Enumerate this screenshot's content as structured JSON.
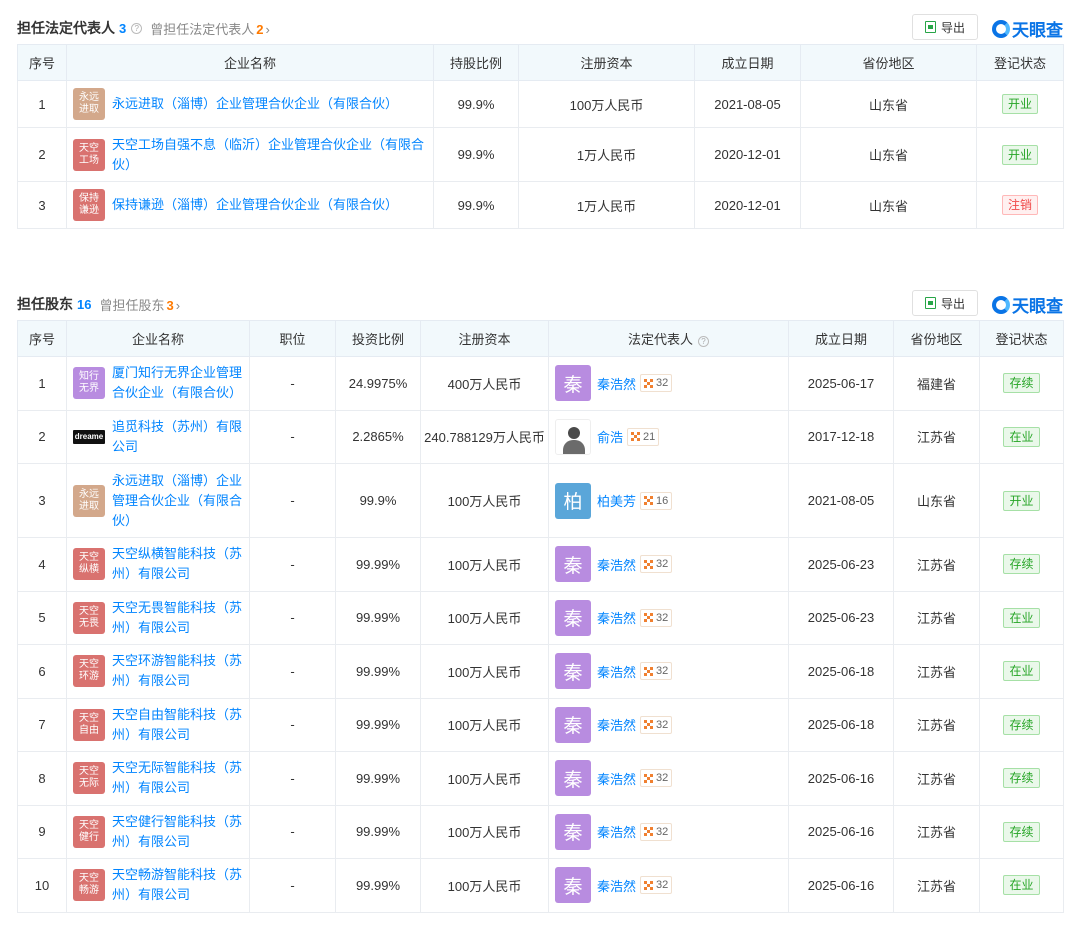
{
  "colors": {
    "accent": "#0084ff",
    "brand": "#0a74e6",
    "count_orange": "#ff7a00",
    "header_bg": "#f2f9fc",
    "status_green": "#26a526",
    "status_red": "#f04848"
  },
  "brand_text": "天眼查",
  "export_label": "导出",
  "legal_rep": {
    "title": "担任法定代表人",
    "count": "3",
    "former_label": "曾担任法定代表人",
    "former_count": "2",
    "headers": [
      "序号",
      "企业名称",
      "持股比例",
      "注册资本",
      "成立日期",
      "省份地区",
      "登记状态"
    ],
    "rows": [
      {
        "index": "1",
        "logo": "永远进取",
        "name": "永远进取（淄博）企业管理合伙企业（有限合伙）",
        "share": "99.9%",
        "capital": "100万人民币",
        "date": "2021-08-05",
        "region": "山东省",
        "status": "开业"
      },
      {
        "index": "2",
        "logo": "天空工场",
        "name": "天空工场自强不息（临沂）企业管理合伙企业（有限合伙）",
        "share": "99.9%",
        "capital": "1万人民币",
        "date": "2020-12-01",
        "region": "山东省",
        "status": "开业"
      },
      {
        "index": "3",
        "logo": "保持谦逊",
        "name": "保持谦逊（淄博）企业管理合伙企业（有限合伙）",
        "share": "99.9%",
        "capital": "1万人民币",
        "date": "2020-12-01",
        "region": "山东省",
        "status": "注销"
      }
    ]
  },
  "shareholder": {
    "title": "担任股东",
    "count": "16",
    "former_label": "曾担任股东",
    "former_count": "3",
    "headers": [
      "序号",
      "企业名称",
      "职位",
      "投资比例",
      "注册资本",
      "法定代表人",
      "成立日期",
      "省份地区",
      "登记状态"
    ],
    "rows": [
      {
        "index": "1",
        "logo": "知行无界",
        "name": "厦门知行无界企业管理合伙企业（有限合伙）",
        "position": "-",
        "ratio": "24.9975%",
        "capital": "400万人民币",
        "rep_avatar": "秦",
        "rep_name": "秦浩然",
        "rep_count": "32",
        "date": "2025-06-17",
        "region": "福建省",
        "status": "存续"
      },
      {
        "index": "2",
        "logo": "dreame",
        "name": "追觅科技（苏州）有限公司",
        "position": "-",
        "ratio": "2.2865%",
        "capital": "240.788129万人民币",
        "rep_avatar": "",
        "rep_name": "俞浩",
        "rep_count": "21",
        "date": "2017-12-18",
        "region": "江苏省",
        "status": "在业"
      },
      {
        "index": "3",
        "logo": "永远进取",
        "name": "永远进取（淄博）企业管理合伙企业（有限合伙）",
        "position": "-",
        "ratio": "99.9%",
        "capital": "100万人民币",
        "rep_avatar": "柏",
        "rep_name": "柏美芳",
        "rep_count": "16",
        "date": "2021-08-05",
        "region": "山东省",
        "status": "开业"
      },
      {
        "index": "4",
        "logo": "天空纵横",
        "name": "天空纵横智能科技（苏州）有限公司",
        "position": "-",
        "ratio": "99.99%",
        "capital": "100万人民币",
        "rep_avatar": "秦",
        "rep_name": "秦浩然",
        "rep_count": "32",
        "date": "2025-06-23",
        "region": "江苏省",
        "status": "存续"
      },
      {
        "index": "5",
        "logo": "天空无畏",
        "name": "天空无畏智能科技（苏州）有限公司",
        "position": "-",
        "ratio": "99.99%",
        "capital": "100万人民币",
        "rep_avatar": "秦",
        "rep_name": "秦浩然",
        "rep_count": "32",
        "date": "2025-06-23",
        "region": "江苏省",
        "status": "在业"
      },
      {
        "index": "6",
        "logo": "天空环游",
        "name": "天空环游智能科技（苏州）有限公司",
        "position": "-",
        "ratio": "99.99%",
        "capital": "100万人民币",
        "rep_avatar": "秦",
        "rep_name": "秦浩然",
        "rep_count": "32",
        "date": "2025-06-18",
        "region": "江苏省",
        "status": "在业"
      },
      {
        "index": "7",
        "logo": "天空自由",
        "name": "天空自由智能科技（苏州）有限公司",
        "position": "-",
        "ratio": "99.99%",
        "capital": "100万人民币",
        "rep_avatar": "秦",
        "rep_name": "秦浩然",
        "rep_count": "32",
        "date": "2025-06-18",
        "region": "江苏省",
        "status": "存续"
      },
      {
        "index": "8",
        "logo": "天空无际",
        "name": "天空无际智能科技（苏州）有限公司",
        "position": "-",
        "ratio": "99.99%",
        "capital": "100万人民币",
        "rep_avatar": "秦",
        "rep_name": "秦浩然",
        "rep_count": "32",
        "date": "2025-06-16",
        "region": "江苏省",
        "status": "存续"
      },
      {
        "index": "9",
        "logo": "天空健行",
        "name": "天空健行智能科技（苏州）有限公司",
        "position": "-",
        "ratio": "99.99%",
        "capital": "100万人民币",
        "rep_avatar": "秦",
        "rep_name": "秦浩然",
        "rep_count": "32",
        "date": "2025-06-16",
        "region": "江苏省",
        "status": "存续"
      },
      {
        "index": "10",
        "logo": "天空畅游",
        "name": "天空畅游智能科技（苏州）有限公司",
        "position": "-",
        "ratio": "99.99%",
        "capital": "100万人民币",
        "rep_avatar": "秦",
        "rep_name": "秦浩然",
        "rep_count": "32",
        "date": "2025-06-16",
        "region": "江苏省",
        "status": "在业"
      }
    ]
  }
}
